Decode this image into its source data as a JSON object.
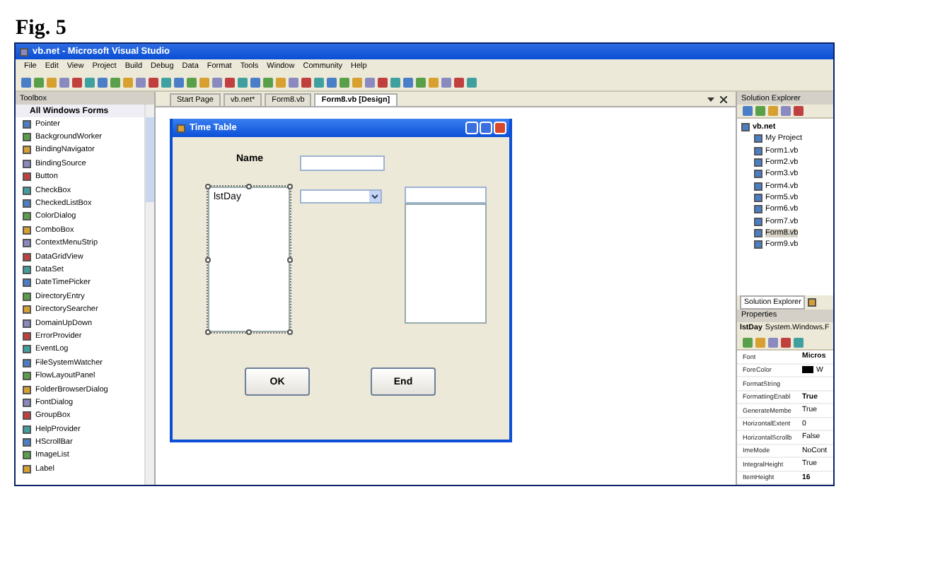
{
  "figure_label": "Fig. 5",
  "window": {
    "title": "vb.net - Microsoft Visual Studio"
  },
  "menu": [
    "File",
    "Edit",
    "View",
    "Project",
    "Build",
    "Debug",
    "Data",
    "Format",
    "Tools",
    "Window",
    "Community",
    "Help"
  ],
  "toolbox": {
    "title": "Toolbox",
    "group": "All Windows Forms",
    "items": [
      "Pointer",
      "BackgroundWorker",
      "BindingNavigator",
      "BindingSource",
      "Button",
      "CheckBox",
      "CheckedListBox",
      "ColorDialog",
      "ComboBox",
      "ContextMenuStrip",
      "DataGridView",
      "DataSet",
      "DateTimePicker",
      "DirectoryEntry",
      "DirectorySearcher",
      "DomainUpDown",
      "ErrorProvider",
      "EventLog",
      "FileSystemWatcher",
      "FlowLayoutPanel",
      "FolderBrowserDialog",
      "FontDialog",
      "GroupBox",
      "HelpProvider",
      "HScrollBar",
      "ImageList",
      "Label"
    ]
  },
  "document_tabs": [
    {
      "label": "Start Page",
      "selected": false
    },
    {
      "label": "vb.net*",
      "selected": false
    },
    {
      "label": "Form8.vb",
      "selected": false
    },
    {
      "label": "Form8.vb [Design]",
      "selected": true
    }
  ],
  "form": {
    "title": "Time Table",
    "controls": [
      {
        "kind": "label",
        "text": "Name",
        "selected": false
      },
      {
        "kind": "textbox",
        "selected": false
      },
      {
        "kind": "listbox",
        "text": "lstDay",
        "selected": true
      },
      {
        "kind": "combobox",
        "selected": false
      },
      {
        "kind": "textbox",
        "selected": false
      },
      {
        "kind": "listbox",
        "selected": false
      },
      {
        "kind": "button",
        "text": "OK",
        "selected": false
      },
      {
        "kind": "button",
        "text": "End",
        "selected": false
      }
    ]
  },
  "solution_explorer": {
    "title": "Solution Explorer",
    "project": "vb.net",
    "items": [
      {
        "label": "My Project",
        "selected": false
      },
      {
        "label": "Form1.vb",
        "selected": false
      },
      {
        "label": "Form2.vb",
        "selected": false
      },
      {
        "label": "Form3.vb",
        "selected": false
      },
      {
        "label": "Form4.vb",
        "selected": false
      },
      {
        "label": "Form5.vb",
        "selected": false
      },
      {
        "label": "Form6.vb",
        "selected": false
      },
      {
        "label": "Form7.vb",
        "selected": false
      },
      {
        "label": "Form8.vb",
        "selected": true
      },
      {
        "label": "Form9.vb",
        "selected": false
      }
    ],
    "tab": "Solution Explorer"
  },
  "properties": {
    "title": "Properties",
    "object": "lstDay",
    "object_type": "System.Windows.F",
    "rows": [
      {
        "name": "Font",
        "value": "Micros",
        "modified": true
      },
      {
        "name": "ForeColor",
        "value": "W",
        "color": "#000000",
        "modified": false
      },
      {
        "name": "FormatString"
      },
      {
        "name": "FormattingEnabl",
        "value": "True",
        "modified": true
      },
      {
        "name": "GenerateMembe",
        "value": "True",
        "modified": false
      },
      {
        "name": "HorizontalExtent",
        "value": "0",
        "modified": false
      },
      {
        "name": "HorizontalScrollb",
        "value": "False",
        "modified": false
      },
      {
        "name": "ImeMode",
        "value": "NoCont",
        "modified": false
      },
      {
        "name": "IntegralHeight",
        "value": "True",
        "modified": false
      },
      {
        "name": "ItemHeight",
        "value": "16",
        "modified": true
      }
    ]
  }
}
